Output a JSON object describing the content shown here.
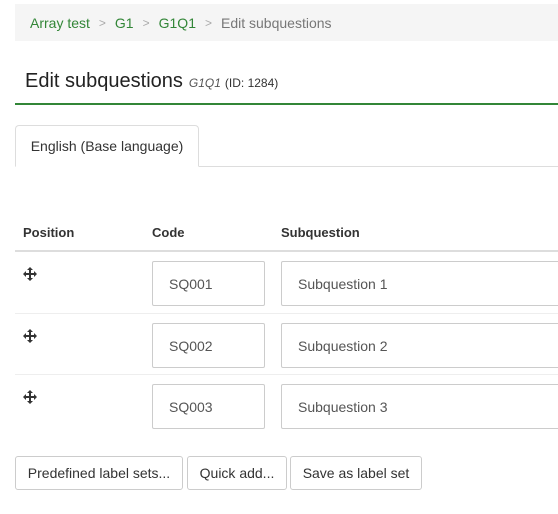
{
  "breadcrumb": {
    "items": [
      "Array test",
      "G1",
      "G1Q1"
    ],
    "current": "Edit subquestions",
    "separator": ">"
  },
  "heading": {
    "title": "Edit subquestions",
    "code": "G1Q1",
    "id_text": "(ID: 1284)"
  },
  "tabs": [
    {
      "label": "English (Base language)",
      "active": true
    }
  ],
  "table": {
    "headers": {
      "position": "Position",
      "code": "Code",
      "subquestion": "Subquestion"
    },
    "rows": [
      {
        "code": "SQ001",
        "subquestion": "Subquestion 1"
      },
      {
        "code": "SQ002",
        "subquestion": "Subquestion 2"
      },
      {
        "code": "SQ003",
        "subquestion": "Subquestion 3"
      }
    ]
  },
  "buttons": {
    "predefined": "Predefined label sets...",
    "quick_add": "Quick add...",
    "save_label_set": "Save as label set"
  },
  "colors": {
    "accent": "#328637",
    "breadcrumb_bg": "#f5f5f5",
    "border": "#cccccc"
  },
  "icons": {
    "move": "move-arrows-icon"
  }
}
